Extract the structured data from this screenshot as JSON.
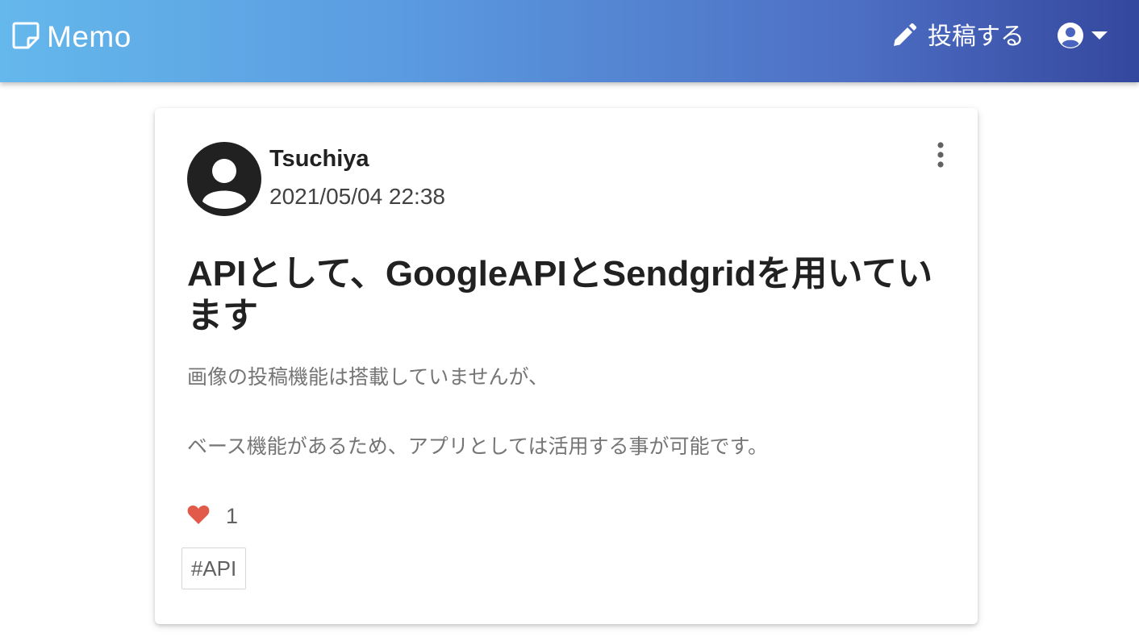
{
  "nav": {
    "brand": "Memo",
    "post_label": "投稿する"
  },
  "post": {
    "author": "Tsuchiya",
    "date": "2021/05/04 22:38",
    "title": "APIとして、GoogleAPIとSendgridを用いています",
    "body": [
      "画像の投稿機能は搭載していませんが、",
      "ベース機能があるため、アプリとしては活用する事が可能です。"
    ],
    "like_count": "1",
    "tags": [
      "#API"
    ]
  },
  "colors": {
    "heart": "#e25a4a",
    "nav_gradient_start": "#64b8ec",
    "nav_gradient_end": "#34479e"
  },
  "icons": {
    "brand": "sticky-note-icon",
    "post": "pencil-icon",
    "user": "user-circle-icon",
    "dropdown": "caret-down-icon",
    "avatar": "user-avatar-icon",
    "menu": "vertical-dots-icon",
    "like": "heart-icon"
  }
}
